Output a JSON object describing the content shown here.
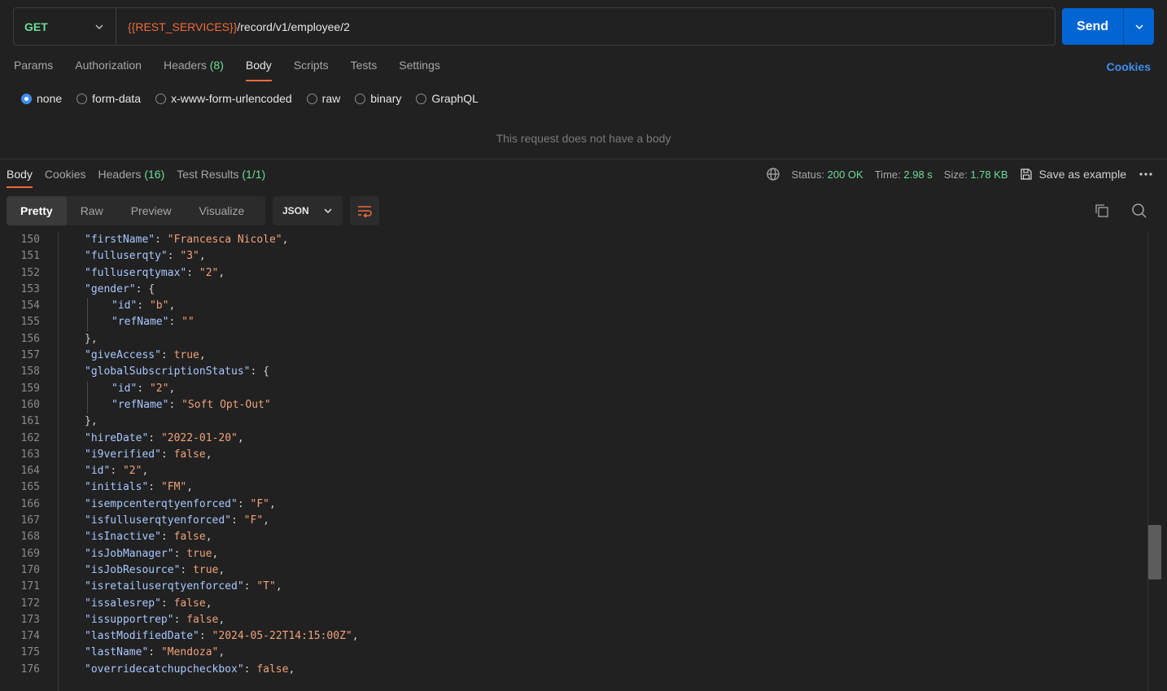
{
  "request": {
    "method": "GET",
    "url_variable": "{{REST_SERVICES}}",
    "url_path": "/record/v1/employee/2",
    "send_label": "Send"
  },
  "request_tabs": [
    {
      "label": "Params",
      "count": ""
    },
    {
      "label": "Authorization",
      "count": ""
    },
    {
      "label": "Headers",
      "count": "(8)"
    },
    {
      "label": "Body",
      "count": ""
    },
    {
      "label": "Scripts",
      "count": ""
    },
    {
      "label": "Tests",
      "count": ""
    },
    {
      "label": "Settings",
      "count": ""
    }
  ],
  "cookies_link": "Cookies",
  "body_types": [
    "none",
    "form-data",
    "x-www-form-urlencoded",
    "raw",
    "binary",
    "GraphQL"
  ],
  "body_selected": "none",
  "no_body_message": "This request does not have a body",
  "response_tabs": [
    {
      "label": "Body",
      "count": ""
    },
    {
      "label": "Cookies",
      "count": ""
    },
    {
      "label": "Headers",
      "count": "(16)"
    },
    {
      "label": "Test Results",
      "count": "(1/1)"
    }
  ],
  "response_meta": {
    "status_label": "Status:",
    "status_value": "200 OK",
    "time_label": "Time:",
    "time_value": "2.98 s",
    "size_label": "Size:",
    "size_value": "1.78 KB",
    "save_example": "Save as example"
  },
  "view_modes": [
    "Pretty",
    "Raw",
    "Preview",
    "Visualize"
  ],
  "format": "JSON",
  "code_lines": [
    {
      "n": "150",
      "indent": 1,
      "key": "firstName",
      "val": "\"Francesca Nicole\"",
      "type": "s",
      "tail": ","
    },
    {
      "n": "151",
      "indent": 1,
      "key": "fulluserqty",
      "val": "\"3\"",
      "type": "s",
      "tail": ","
    },
    {
      "n": "152",
      "indent": 1,
      "key": "fulluserqtymax",
      "val": "\"2\"",
      "type": "s",
      "tail": ","
    },
    {
      "n": "153",
      "indent": 1,
      "key": "gender",
      "val": "{",
      "type": "p",
      "tail": ""
    },
    {
      "n": "154",
      "indent": 2,
      "key": "id",
      "val": "\"b\"",
      "type": "s",
      "tail": ","
    },
    {
      "n": "155",
      "indent": 2,
      "key": "refName",
      "val": "\"\"",
      "type": "s",
      "tail": ""
    },
    {
      "n": "156",
      "indent": 1,
      "key": "",
      "val": "},",
      "type": "p",
      "tail": ""
    },
    {
      "n": "157",
      "indent": 1,
      "key": "giveAccess",
      "val": "true",
      "type": "b",
      "tail": ","
    },
    {
      "n": "158",
      "indent": 1,
      "key": "globalSubscriptionStatus",
      "val": "{",
      "type": "p",
      "tail": ""
    },
    {
      "n": "159",
      "indent": 2,
      "key": "id",
      "val": "\"2\"",
      "type": "s",
      "tail": ","
    },
    {
      "n": "160",
      "indent": 2,
      "key": "refName",
      "val": "\"Soft Opt-Out\"",
      "type": "s",
      "tail": ""
    },
    {
      "n": "161",
      "indent": 1,
      "key": "",
      "val": "},",
      "type": "p",
      "tail": ""
    },
    {
      "n": "162",
      "indent": 1,
      "key": "hireDate",
      "val": "\"2022-01-20\"",
      "type": "s",
      "tail": ","
    },
    {
      "n": "163",
      "indent": 1,
      "key": "i9verified",
      "val": "false",
      "type": "b",
      "tail": ","
    },
    {
      "n": "164",
      "indent": 1,
      "key": "id",
      "val": "\"2\"",
      "type": "s",
      "tail": ","
    },
    {
      "n": "165",
      "indent": 1,
      "key": "initials",
      "val": "\"FM\"",
      "type": "s",
      "tail": ","
    },
    {
      "n": "166",
      "indent": 1,
      "key": "isempcenterqtyenforced",
      "val": "\"F\"",
      "type": "s",
      "tail": ","
    },
    {
      "n": "167",
      "indent": 1,
      "key": "isfulluserqtyenforced",
      "val": "\"F\"",
      "type": "s",
      "tail": ","
    },
    {
      "n": "168",
      "indent": 1,
      "key": "isInactive",
      "val": "false",
      "type": "b",
      "tail": ","
    },
    {
      "n": "169",
      "indent": 1,
      "key": "isJobManager",
      "val": "true",
      "type": "b",
      "tail": ","
    },
    {
      "n": "170",
      "indent": 1,
      "key": "isJobResource",
      "val": "true",
      "type": "b",
      "tail": ","
    },
    {
      "n": "171",
      "indent": 1,
      "key": "isretailuserqtyenforced",
      "val": "\"T\"",
      "type": "s",
      "tail": ","
    },
    {
      "n": "172",
      "indent": 1,
      "key": "issalesrep",
      "val": "false",
      "type": "b",
      "tail": ","
    },
    {
      "n": "173",
      "indent": 1,
      "key": "issupportrep",
      "val": "false",
      "type": "b",
      "tail": ","
    },
    {
      "n": "174",
      "indent": 1,
      "key": "lastModifiedDate",
      "val": "\"2024-05-22T14:15:00Z\"",
      "type": "s",
      "tail": ","
    },
    {
      "n": "175",
      "indent": 1,
      "key": "lastName",
      "val": "\"Mendoza\"",
      "type": "s",
      "tail": ","
    },
    {
      "n": "176",
      "indent": 1,
      "key": "overridecatchupcheckbox",
      "val": "false",
      "type": "b",
      "tail": ","
    }
  ],
  "colors": {
    "accent": "#f26b3a",
    "primary_button": "#0265d2",
    "success": "#6bdd9a",
    "link": "#3e8ef1"
  }
}
